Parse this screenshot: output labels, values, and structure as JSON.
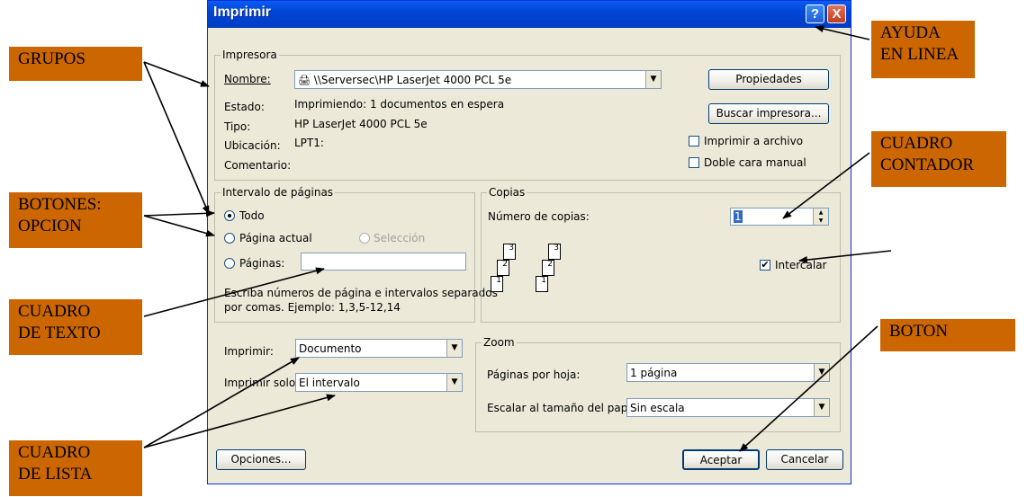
{
  "dialog": {
    "title": "Imprimir",
    "help_symbol": "?",
    "close_symbol": "X",
    "printer": {
      "group_label": "Impresora",
      "name_label": "Nombre:",
      "name_value": "\\\\Serversec\\HP LaserJet 4000 PCL 5e",
      "status_label": "Estado:",
      "status_value": "Imprimiendo: 1 documentos en espera",
      "type_label": "Tipo:",
      "type_value": "HP LaserJet 4000 PCL 5e",
      "location_label": "Ubicación:",
      "location_value": "LPT1:",
      "comment_label": "Comentario:",
      "properties_button": "Propiedades",
      "find_button": "Buscar impresora...",
      "print_to_file_label": "Imprimir a archivo",
      "manual_duplex_label": "Doble cara manual"
    },
    "range": {
      "group_label": "Intervalo de páginas",
      "all_label": "Todo",
      "current_label": "Página actual",
      "selection_label": "Selección",
      "pages_label": "Páginas:",
      "hint_line1": "Escriba números de página e intervalos separados",
      "hint_line2": "por comas. Ejemplo: 1,3,5-12,14"
    },
    "copies": {
      "group_label": "Copias",
      "count_label": "Número de copias:",
      "count_value": "1",
      "collate_label": "Intercalar",
      "collate_checked": true
    },
    "print_what": {
      "label": "Imprimir:",
      "value": "Documento"
    },
    "print_only": {
      "label": "Imprimir solo:",
      "value": "El intervalo"
    },
    "zoom": {
      "group_label": "Zoom",
      "pages_per_sheet_label": "Páginas por hoja:",
      "pages_per_sheet_value": "1 página",
      "scale_label": "Escalar al tamaño del papel:",
      "scale_value": "Sin escala"
    },
    "options_button": "Opciones...",
    "ok_button": "Aceptar",
    "cancel_button": "Cancelar"
  },
  "callouts": {
    "grupos": "GRUPOS",
    "ayuda_1": "AYUDA",
    "ayuda_2": "EN LINEA",
    "botones_1": "BOTONES:",
    "botones_2": "OPCION",
    "contador_1": "CUADRO",
    "contador_2": "CONTADOR",
    "texto_1": "CUADRO",
    "texto_2": "DE TEXTO",
    "boton": "BOTON",
    "lista_1": "CUADRO",
    "lista_2": "DE LISTA"
  },
  "colors": {
    "callout_bg": "#cc6600",
    "titlebar": "#0045d6",
    "dialog_bg": "#ece9d8"
  },
  "page_icon_numbers": [
    "1",
    "2",
    "3"
  ]
}
